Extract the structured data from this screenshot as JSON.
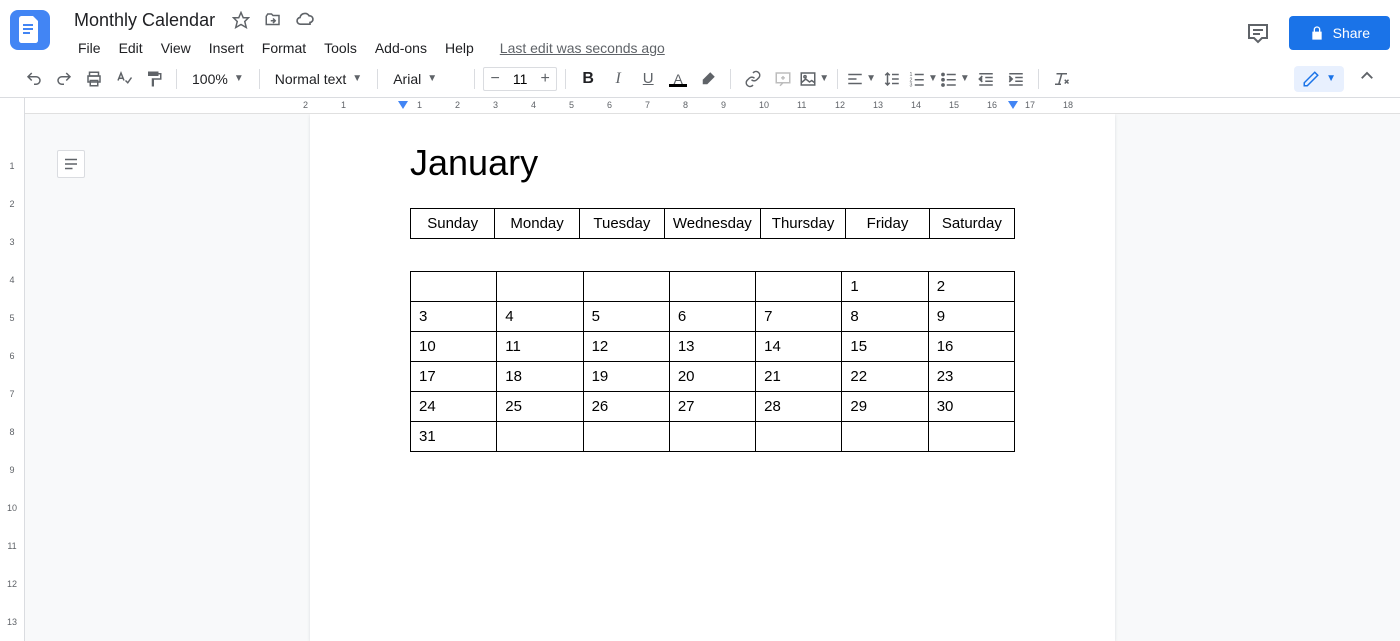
{
  "header": {
    "doc_title": "Monthly Calendar",
    "last_edit": "Last edit was seconds ago",
    "share_label": "Share"
  },
  "menu": [
    "File",
    "Edit",
    "View",
    "Insert",
    "Format",
    "Tools",
    "Add-ons",
    "Help"
  ],
  "toolbar": {
    "zoom": "100%",
    "style": "Normal text",
    "font": "Arial",
    "font_size": "11"
  },
  "document": {
    "heading": "January",
    "day_headers": [
      "Sunday",
      "Monday",
      "Tuesday",
      "Wednesday",
      "Thursday",
      "Friday",
      "Saturday"
    ],
    "day_grid": [
      [
        "",
        "",
        "",
        "",
        "",
        "1",
        "2"
      ],
      [
        "3",
        "4",
        "5",
        "6",
        "7",
        "8",
        "9"
      ],
      [
        "10",
        "11",
        "12",
        "13",
        "14",
        "15",
        "16"
      ],
      [
        "17",
        "18",
        "19",
        "20",
        "21",
        "22",
        "23"
      ],
      [
        "24",
        "25",
        "26",
        "27",
        "28",
        "29",
        "30"
      ],
      [
        "31",
        "",
        "",
        "",
        "",
        "",
        ""
      ]
    ]
  },
  "hruler": [
    2,
    1,
    "",
    1,
    2,
    3,
    4,
    5,
    6,
    7,
    8,
    9,
    10,
    11,
    12,
    13,
    14,
    15,
    16,
    17,
    18
  ],
  "vruler": [
    "",
    1,
    2,
    3,
    4,
    5,
    6,
    7,
    8,
    9,
    10,
    11,
    12,
    13
  ]
}
